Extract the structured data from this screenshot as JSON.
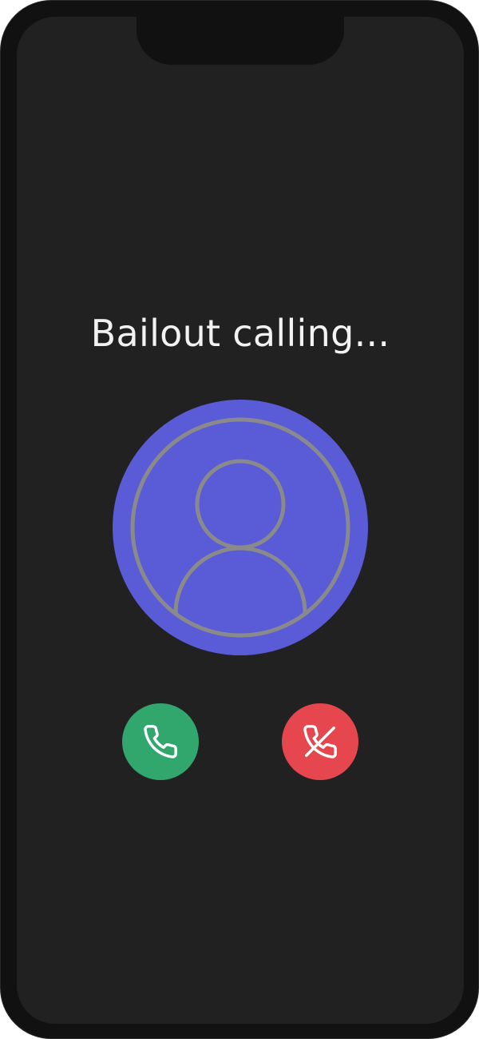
{
  "call": {
    "title": "Bailout calling..."
  },
  "icons": {
    "avatar": "user-avatar-icon",
    "accept": "phone-icon",
    "decline": "phone-off-icon"
  },
  "colors": {
    "screen_background": "#212121",
    "avatar_background": "#5a5bd6",
    "avatar_outline": "#8a8a8a",
    "accept_button": "#31a76e",
    "decline_button": "#e6474e",
    "text": "#f2f2f2"
  }
}
